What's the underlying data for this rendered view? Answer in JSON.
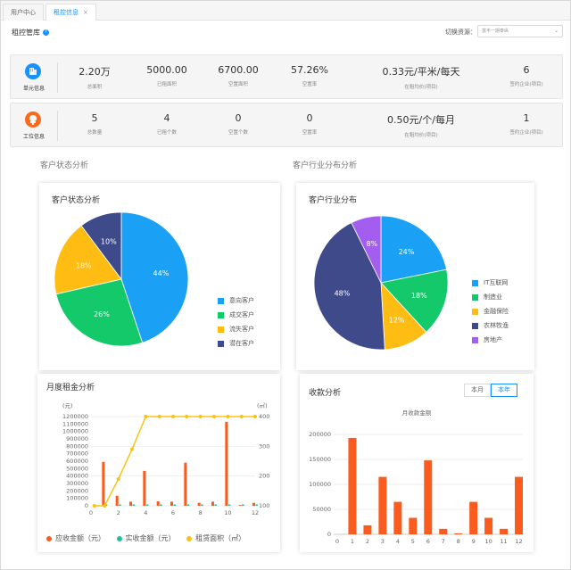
{
  "tabs": [
    {
      "label": "用户中心"
    },
    {
      "label": "租控信息",
      "close": "×"
    }
  ],
  "header": {
    "title": "租控管库",
    "help": "?",
    "switch_label": "切换资源：",
    "switch_value": "富丰一期泰纵"
  },
  "unit_box": {
    "title": "单元信息",
    "stats": [
      {
        "value": "2.20万",
        "label": "总面积"
      },
      {
        "value": "5000.00",
        "label": "已租面积"
      },
      {
        "value": "6700.00",
        "label": "空置面积"
      },
      {
        "value": "57.26%",
        "label": "空置率"
      },
      {
        "value": "0.33元/平米/每天",
        "label": "在租均价(项目)"
      },
      {
        "value": "6",
        "label": "签约企业(项目)"
      }
    ]
  },
  "station_box": {
    "title": "工位信息",
    "stats": [
      {
        "value": "5",
        "label": "总数量"
      },
      {
        "value": "4",
        "label": "已租个数"
      },
      {
        "value": "0",
        "label": "空置个数"
      },
      {
        "value": "0",
        "label": "空置率"
      },
      {
        "value": "0.50元/个/每月",
        "label": "在租均价(项目)"
      },
      {
        "value": "1",
        "label": "签约企业(项目)"
      }
    ]
  },
  "sections": {
    "customer": "客户状态分析",
    "industry": "客户行业分布分析"
  },
  "colors": {
    "blue": "#1aa0f5",
    "green": "#13c96a",
    "yellow": "#ffbc13",
    "navy": "#3e4a8a",
    "purple": "#a35ef0",
    "orange": "#fa5b1e",
    "teal": "#1fbf9f",
    "gold": "#f9c316",
    "accent": "#1890ff"
  },
  "customer_pie": {
    "title": "客户状态分析",
    "slices": [
      {
        "name": "意向客户",
        "value": 44,
        "label": "44%",
        "color": "#1aa0f5"
      },
      {
        "name": "成交客户",
        "value": 26,
        "label": "26%",
        "color": "#13c96a"
      },
      {
        "name": "流失客户",
        "value": 18,
        "label": "18%",
        "color": "#ffbc13"
      },
      {
        "name": "潜在客户",
        "value": 10,
        "label": "10%",
        "color": "#3e4a8a"
      }
    ]
  },
  "industry_pie": {
    "title": "客户行业分布",
    "slices": [
      {
        "name": "IT互联网",
        "value": 24,
        "label": "24%",
        "color": "#1aa0f5"
      },
      {
        "name": "制造业",
        "value": 18,
        "label": "18%",
        "color": "#13c96a"
      },
      {
        "name": "金融保险",
        "value": 12,
        "label": "12%",
        "color": "#ffbc13"
      },
      {
        "name": "农林牧渔",
        "value": 48,
        "label": "48%",
        "color": "#3e4a8a"
      },
      {
        "name": "房地产",
        "value": 8,
        "label": "8%",
        "color": "#a35ef0"
      }
    ]
  },
  "rent_chart": {
    "title": "月度租金分析",
    "left_unit": "(元)",
    "right_unit": "(㎡)",
    "legend": [
      "应收金额（元）",
      "实收金额（元）",
      "租赁面积（㎡）"
    ]
  },
  "collect_chart": {
    "title": "收款分析",
    "subtitle": "月收款金额",
    "buttons": [
      "本月",
      "本年"
    ]
  },
  "chart_data": [
    {
      "type": "pie",
      "title": "客户状态分析",
      "categories": [
        "意向客户",
        "成交客户",
        "流失客户",
        "潜在客户"
      ],
      "values": [
        44,
        26,
        18,
        10
      ]
    },
    {
      "type": "pie",
      "title": "客户行业分布",
      "categories": [
        "IT互联网",
        "制造业",
        "金融保险",
        "农林牧渔",
        "房地产"
      ],
      "values": [
        24,
        18,
        12,
        48,
        8
      ]
    },
    {
      "type": "bar",
      "title": "月度租金分析",
      "x": [
        1,
        2,
        3,
        4,
        5,
        6,
        7,
        8,
        9,
        10,
        11,
        12
      ],
      "xticks": [
        0,
        2,
        4,
        6,
        8,
        10,
        12
      ],
      "ylim": [
        0,
        1200000
      ],
      "yticks": [
        0,
        100000,
        200000,
        300000,
        400000,
        500000,
        600000,
        700000,
        800000,
        900000,
        1000000,
        1100000,
        1200000
      ],
      "y2lim": [
        100,
        400
      ],
      "y2ticks": [
        100,
        200,
        300,
        400
      ],
      "series": [
        {
          "name": "应收金额（元）",
          "values": [
            590000,
            135000,
            55000,
            470000,
            60000,
            55000,
            580000,
            40000,
            55000,
            1130000,
            10000,
            40000
          ]
        },
        {
          "name": "实收金额（元）",
          "values": [
            0,
            0,
            0,
            0,
            0,
            0,
            0,
            0,
            0,
            0,
            0,
            0
          ]
        },
        {
          "name": "租赁面积（㎡）",
          "axis": "right",
          "x": [
            0.25,
            1,
            2,
            3,
            4,
            5,
            6,
            7,
            8,
            9,
            10,
            11,
            12
          ],
          "values": [
            0,
            0,
            190,
            290,
            400,
            400,
            400,
            400,
            400,
            400,
            400,
            400,
            400
          ]
        }
      ],
      "legend": "bottom"
    },
    {
      "type": "bar",
      "title": "月收款金额",
      "x": [
        1,
        2,
        3,
        4,
        5,
        6,
        7,
        8,
        9,
        10,
        11,
        12
      ],
      "xticks": [
        0,
        1,
        2,
        3,
        4,
        5,
        6,
        7,
        8,
        9,
        10,
        11,
        12
      ],
      "ylim": [
        0,
        200000
      ],
      "yticks": [
        0,
        50000,
        100000,
        150000,
        200000
      ],
      "values": [
        193000,
        18000,
        115000,
        65000,
        33000,
        148000,
        11000,
        2000,
        65000,
        33000,
        11000,
        115000
      ]
    }
  ]
}
